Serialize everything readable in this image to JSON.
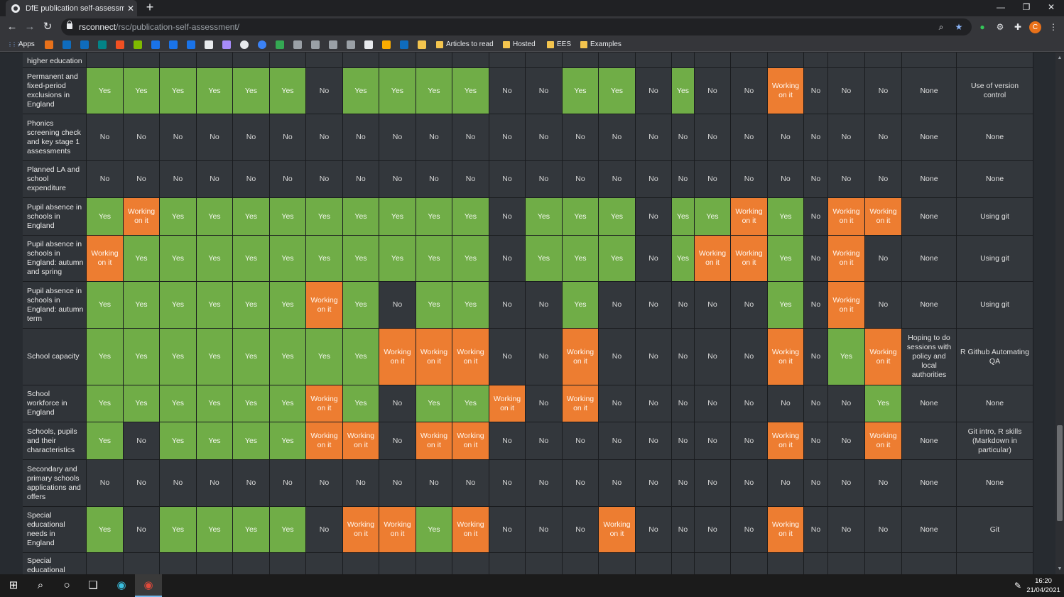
{
  "browser": {
    "tab_title": "DfE publication self-assessment",
    "tab_close": "✕",
    "new_tab": "+",
    "url_host": "rsconnect",
    "url_path": "/rsc/publication-self-assessment/",
    "window_controls": [
      "—",
      "❐",
      "✕"
    ],
    "apps_label": "Apps",
    "bookmark_folders": [
      "Articles to read",
      "Hosted",
      "EES",
      "Examples"
    ],
    "avatar_letter": "C"
  },
  "table": {
    "top_partial_label": "higher education",
    "rows": [
      {
        "name": "Permanent and fixed-period exclusions in England",
        "cells": [
          "Yes",
          "Yes",
          "Yes",
          "Yes",
          "Yes",
          "Yes",
          "No",
          "Yes",
          "Yes",
          "Yes",
          "Yes",
          "No",
          "No",
          "Yes",
          "Yes",
          "No",
          "Yes",
          "No",
          "No",
          "Working on it",
          "No",
          "No",
          "No"
        ],
        "comment": "None",
        "notes": "Use of version control"
      },
      {
        "name": "Phonics screening check and key stage 1 assessments",
        "cells": [
          "No",
          "No",
          "No",
          "No",
          "No",
          "No",
          "No",
          "No",
          "No",
          "No",
          "No",
          "No",
          "No",
          "No",
          "No",
          "No",
          "No",
          "No",
          "No",
          "No",
          "No",
          "No",
          "No"
        ],
        "comment": "None",
        "notes": "None"
      },
      {
        "name": "Planned LA and school expenditure",
        "cells": [
          "No",
          "No",
          "No",
          "No",
          "No",
          "No",
          "No",
          "No",
          "No",
          "No",
          "No",
          "No",
          "No",
          "No",
          "No",
          "No",
          "No",
          "No",
          "No",
          "No",
          "No",
          "No",
          "No"
        ],
        "comment": "None",
        "notes": "None"
      },
      {
        "name": "Pupil absence in schools in England",
        "cells": [
          "Yes",
          "Working on it",
          "Yes",
          "Yes",
          "Yes",
          "Yes",
          "Yes",
          "Yes",
          "Yes",
          "Yes",
          "Yes",
          "No",
          "Yes",
          "Yes",
          "Yes",
          "No",
          "Yes",
          "Yes",
          "Working on it",
          "Yes",
          "No",
          "Working on it",
          "Working on it"
        ],
        "comment": "None",
        "notes": "Using git"
      },
      {
        "name": "Pupil absence in schools in England: autumn and spring",
        "cells": [
          "Working on it",
          "Yes",
          "Yes",
          "Yes",
          "Yes",
          "Yes",
          "Yes",
          "Yes",
          "Yes",
          "Yes",
          "Yes",
          "No",
          "Yes",
          "Yes",
          "Yes",
          "No",
          "Yes",
          "Working on it",
          "Working on it",
          "Yes",
          "No",
          "Working on it",
          "No"
        ],
        "comment": "None",
        "notes": "Using git"
      },
      {
        "name": "Pupil absence in schools in England: autumn term",
        "cells": [
          "Yes",
          "Yes",
          "Yes",
          "Yes",
          "Yes",
          "Yes",
          "Working on it",
          "Yes",
          "No",
          "Yes",
          "Yes",
          "No",
          "No",
          "Yes",
          "No",
          "No",
          "No",
          "No",
          "No",
          "Yes",
          "No",
          "Working on it",
          "No"
        ],
        "comment": "None",
        "notes": "Using git"
      },
      {
        "name": "School capacity",
        "cells": [
          "Yes",
          "Yes",
          "Yes",
          "Yes",
          "Yes",
          "Yes",
          "Yes",
          "Yes",
          "Working on it",
          "Working on it",
          "Working on it",
          "No",
          "No",
          "Working on it",
          "No",
          "No",
          "No",
          "No",
          "No",
          "Working on it",
          "No",
          "Yes",
          "Working on it"
        ],
        "comment": "Hoping to do sessions with policy and local authorities",
        "notes": "R Github Automating QA"
      },
      {
        "name": "School workforce in England",
        "cells": [
          "Yes",
          "Yes",
          "Yes",
          "Yes",
          "Yes",
          "Yes",
          "Working on it",
          "Yes",
          "No",
          "Yes",
          "Yes",
          "Working on it",
          "No",
          "Working on it",
          "No",
          "No",
          "No",
          "No",
          "No",
          "No",
          "No",
          "No",
          "Yes"
        ],
        "comment": "None",
        "notes": "None"
      },
      {
        "name": "Schools, pupils and their characteristics",
        "cells": [
          "Yes",
          "No",
          "Yes",
          "Yes",
          "Yes",
          "Yes",
          "Working on it",
          "Working on it",
          "No",
          "Working on it",
          "Working on it",
          "No",
          "No",
          "No",
          "No",
          "No",
          "No",
          "No",
          "No",
          "Working on it",
          "No",
          "No",
          "Working on it"
        ],
        "comment": "None",
        "notes": "Git intro, R skills (Markdown in particular)"
      },
      {
        "name": "Secondary and primary schools applications and offers",
        "cells": [
          "No",
          "No",
          "No",
          "No",
          "No",
          "No",
          "No",
          "No",
          "No",
          "No",
          "No",
          "No",
          "No",
          "No",
          "No",
          "No",
          "No",
          "No",
          "No",
          "No",
          "No",
          "No",
          "No"
        ],
        "comment": "None",
        "notes": "None"
      },
      {
        "name": "Special educational needs in England",
        "cells": [
          "Yes",
          "No",
          "Yes",
          "Yes",
          "Yes",
          "Yes",
          "No",
          "Working on it",
          "Working on it",
          "Yes",
          "Working on it",
          "No",
          "No",
          "No",
          "Working on it",
          "No",
          "No",
          "No",
          "No",
          "Working on it",
          "No",
          "No",
          "No"
        ],
        "comment": "None",
        "notes": "Git"
      }
    ],
    "bottom_partial_label": "Special educational"
  },
  "taskbar": {
    "time": "16:20",
    "date": "21/04/2021"
  },
  "colors": {
    "yes": "#70ad47",
    "working": "#ed7d31",
    "no": "#33373c"
  }
}
